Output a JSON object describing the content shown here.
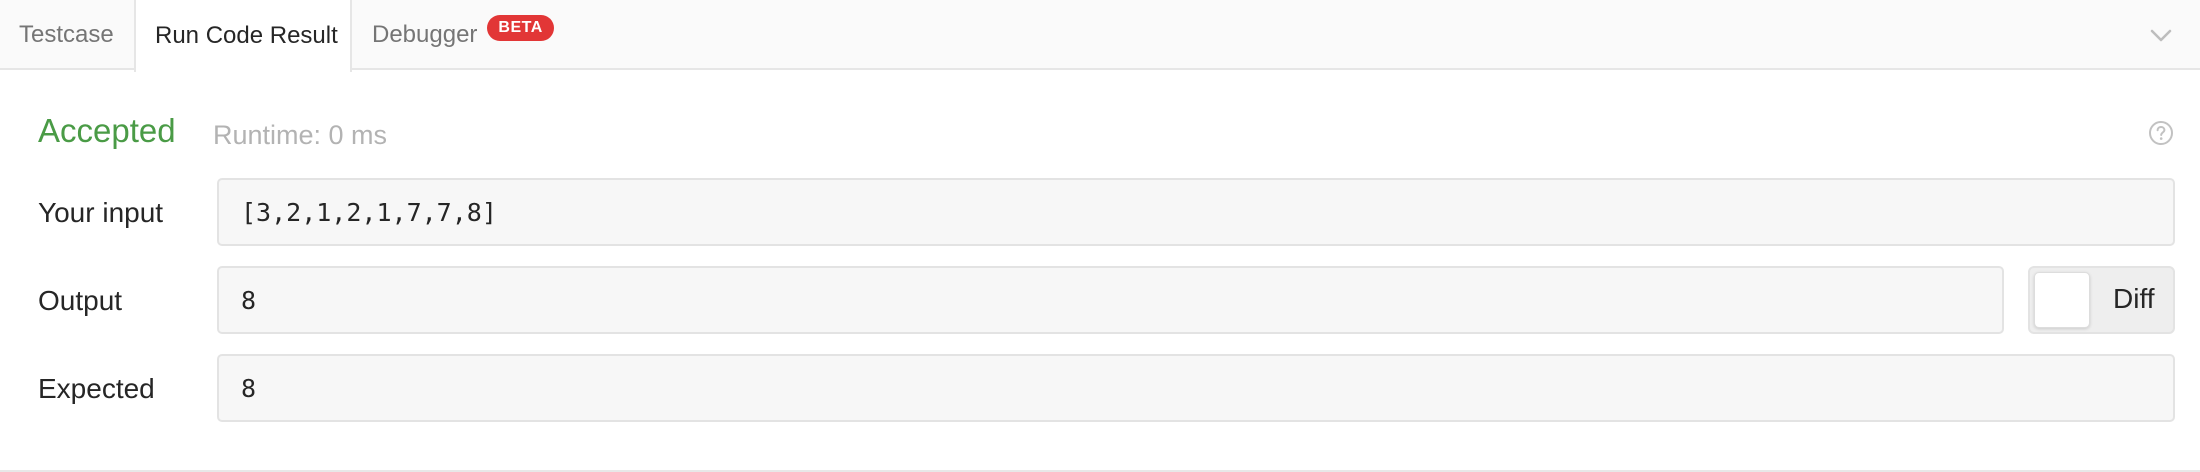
{
  "tabs": [
    {
      "label": "Testcase",
      "active": false
    },
    {
      "label": "Run Code Result",
      "active": true
    },
    {
      "label": "Debugger",
      "active": false,
      "badge": "BETA"
    }
  ],
  "result": {
    "status": "Accepted",
    "runtime": "Runtime: 0 ms",
    "status_color": "#4a9b46"
  },
  "rows": {
    "input": {
      "label": "Your input",
      "value": "[3,2,1,2,1,7,7,8]"
    },
    "output": {
      "label": "Output",
      "value": "8"
    },
    "expected": {
      "label": "Expected",
      "value": "8"
    }
  },
  "diff": {
    "label": "Diff",
    "enabled": false
  },
  "icons": {
    "collapse": "chevron-down-icon",
    "help": "question-circle-icon"
  },
  "colors": {
    "badge": "#e23636",
    "accepted": "#4a9b46"
  }
}
